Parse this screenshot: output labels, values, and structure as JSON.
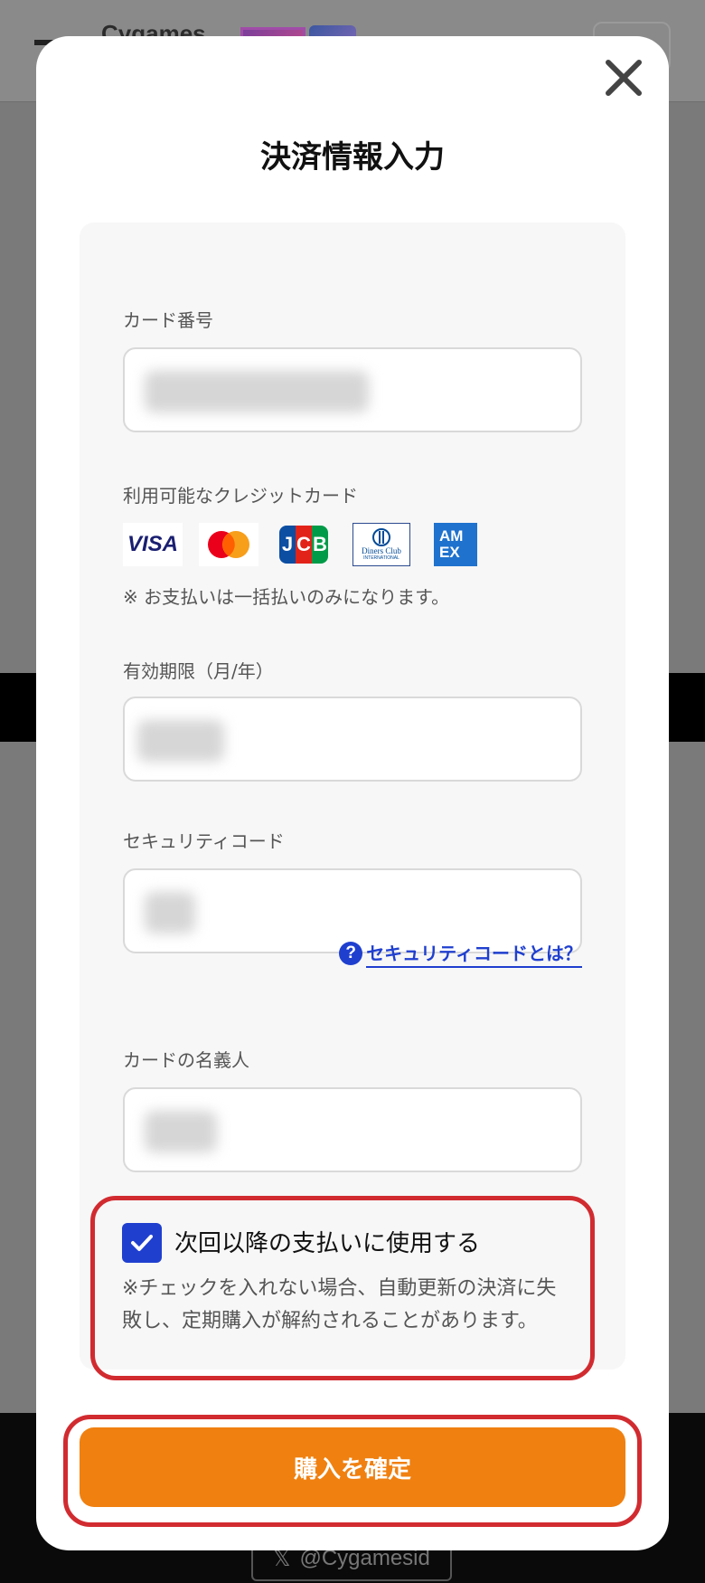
{
  "background": {
    "logo_text": "Cygames",
    "x_button_label": "@Cygamesid"
  },
  "modal": {
    "title": "決済情報入力"
  },
  "form": {
    "card_number": {
      "label": "カード番号"
    },
    "available_cards": {
      "label": "利用可能なクレジットカード",
      "brands": {
        "visa": "VISA",
        "mastercard": "Mastercard",
        "jcb": "JCB",
        "diners_line1": "Diners Club",
        "diners_line2": "INTERNATIONAL",
        "amex_line1": "AM",
        "amex_line2": "EX"
      },
      "note": "※ お支払いは一括払いのみになります。"
    },
    "expiry": {
      "label": "有効期限（月/年）"
    },
    "security_code": {
      "label": "セキュリティコード",
      "help_link": "セキュリティコードとは？"
    },
    "card_holder": {
      "label": "カードの名義人"
    },
    "save_card": {
      "checked": true,
      "label": "次回以降の支払いに使用する",
      "note": "※チェックを入れない場合、自動更新の決済に失敗し、定期購入が解約されることがあります。"
    }
  },
  "confirm_button": "購入を確定",
  "colors": {
    "accent_blue": "#1f3fcf",
    "confirm_orange": "#f08010",
    "highlight_red": "#d12b30"
  }
}
